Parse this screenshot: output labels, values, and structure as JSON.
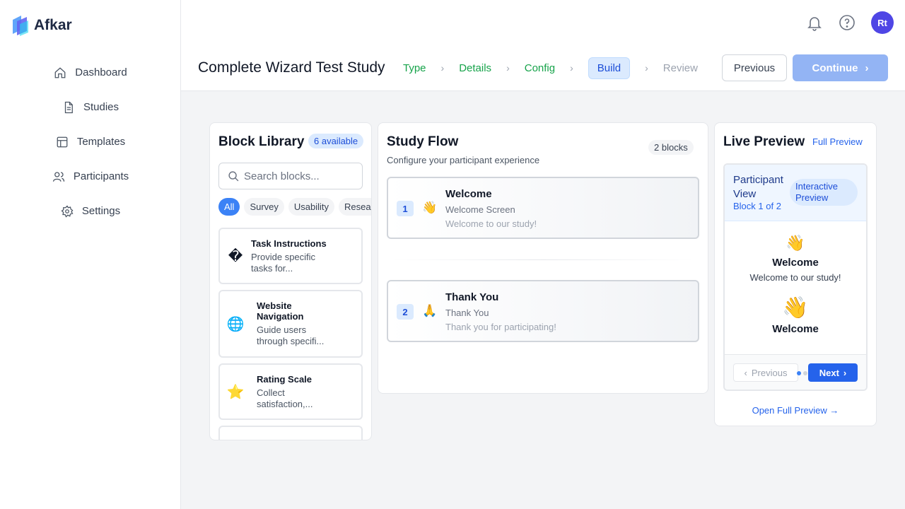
{
  "app": {
    "name": "Afkar"
  },
  "sidebar": {
    "items": [
      {
        "label": "Dashboard"
      },
      {
        "label": "Studies"
      },
      {
        "label": "Templates"
      },
      {
        "label": "Participants"
      },
      {
        "label": "Settings"
      }
    ]
  },
  "header": {
    "avatar_initials": "Rt",
    "title": "Complete Wizard Test Study",
    "steps": [
      {
        "label": "Type",
        "status": "done"
      },
      {
        "label": "Details",
        "status": "done"
      },
      {
        "label": "Config",
        "status": "done"
      },
      {
        "label": "Build",
        "status": "active"
      },
      {
        "label": "Review",
        "status": "todo"
      }
    ],
    "previous_label": "Previous",
    "continue_label": "Continue"
  },
  "library": {
    "title": "Block Library",
    "count_badge": "6 available",
    "search_placeholder": "Search blocks...",
    "filters": [
      "All",
      "Survey",
      "Usability",
      "Research"
    ],
    "blocks": [
      {
        "icon": "�",
        "title": "Task Instructions",
        "desc1": "Provide specific",
        "desc2": "tasks for..."
      },
      {
        "icon": "🌐",
        "title1": "Website",
        "title2": "Navigation",
        "desc1": "Guide users",
        "desc2": "through specifi..."
      },
      {
        "icon": "⭐",
        "title": "Rating Scale",
        "desc1": "Collect",
        "desc2": "satisfaction,..."
      }
    ]
  },
  "flow": {
    "title": "Study Flow",
    "subtitle": "Configure your participant experience",
    "count_badge": "2 blocks",
    "items": [
      {
        "num": "1",
        "emoji": "👋",
        "title": "Welcome",
        "type": "Welcome Screen",
        "desc": "Welcome to our study!"
      },
      {
        "num": "2",
        "emoji": "🙏",
        "title": "Thank You",
        "type": "Thank You",
        "desc": "Thank you for participating!"
      }
    ]
  },
  "preview": {
    "title": "Live Preview",
    "full_link": "Full Preview",
    "view_title": "Participant View",
    "view_sub": "Block 1 of 2",
    "interactive_badge": "Interactive Preview",
    "emoji": "👋",
    "welcome": "Welcome",
    "welcome_msg": "Welcome to our study!",
    "welcome2": "Welcome",
    "prev_label": "Previous",
    "next_label": "Next",
    "open_full": "Open Full Preview →"
  }
}
